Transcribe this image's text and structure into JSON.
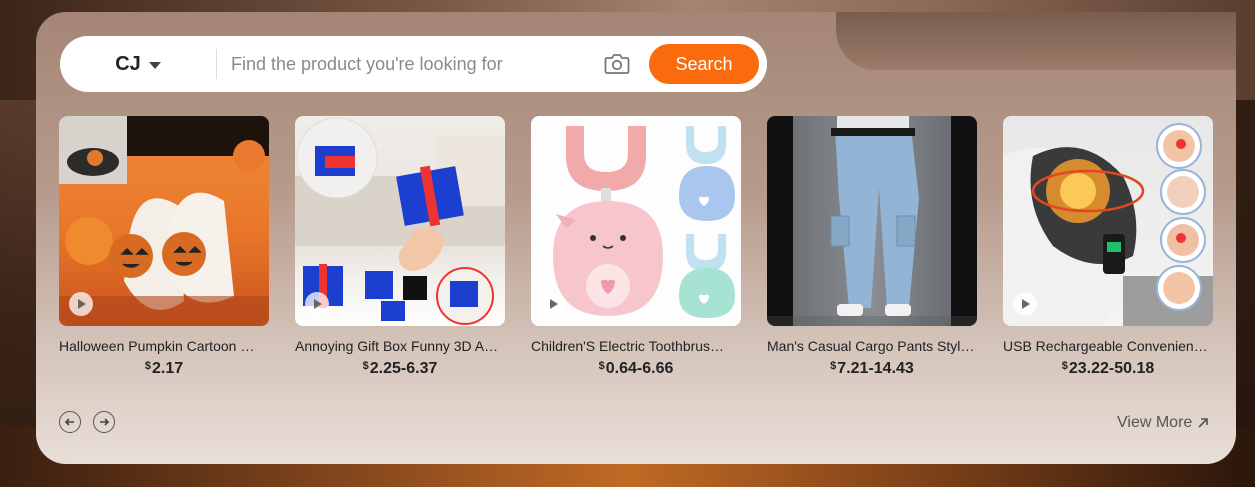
{
  "search": {
    "store": "CJ",
    "placeholder": "Find the product you're looking for",
    "button_label": "Search"
  },
  "products": [
    {
      "title": "Halloween Pumpkin Cartoon …",
      "currency": "$",
      "price": "2.17",
      "image": "pumpkin-slippers"
    },
    {
      "title": "Annoying Gift Box Funny 3D A…",
      "currency": "$",
      "price": "2.25-6.37",
      "image": "gift-box-toy"
    },
    {
      "title": "Children'S Electric Toothbrus…",
      "currency": "$",
      "price": "0.64-6.66",
      "image": "kids-u-toothbrush"
    },
    {
      "title": "Man's Casual Cargo Pants Styl…",
      "currency": "$",
      "price": "7.21-14.43",
      "image": "cargo-jeans"
    },
    {
      "title": "USB Rechargeable Convenien…",
      "currency": "$",
      "price": "23.22-50.18",
      "image": "heated-shoulder-brace"
    }
  ],
  "view_more": "View More",
  "colors": {
    "accent": "#fa6b0d"
  }
}
